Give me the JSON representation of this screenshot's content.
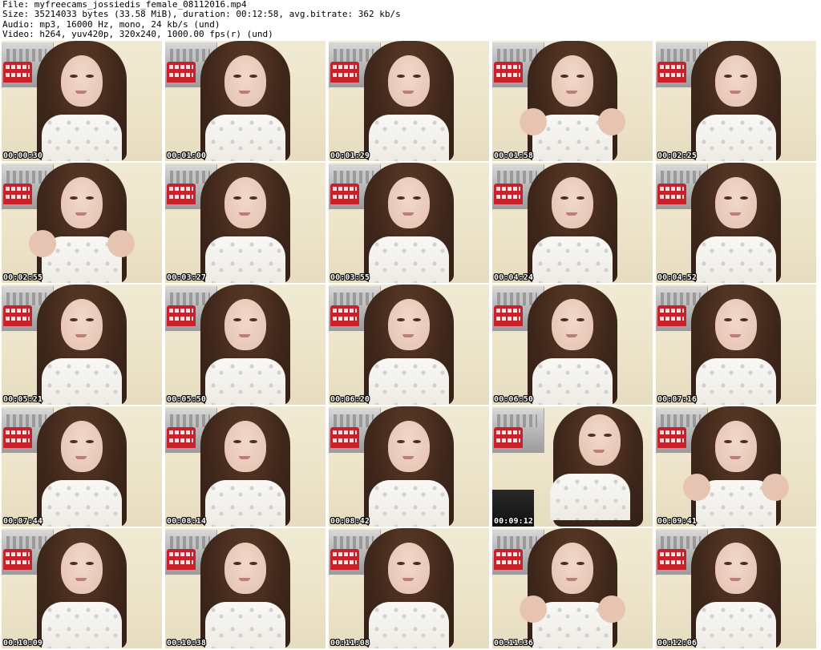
{
  "header": {
    "file": "File: myfreecams_jossiedis_female_08112016.mp4",
    "size": "Size: 35214033 bytes (33.58 MiB), duration: 00:12:58, avg.bitrate: 362 kb/s",
    "audio": "Audio: mp3, 16000 Hz, mono, 24 kb/s (und)",
    "video": "Video: h264, yuv420p, 320x240, 1000.00 fps(r) (und)"
  },
  "thumbnails": [
    "00:00:30",
    "00:01:00",
    "00:01:29",
    "00:01:58",
    "00:02:25",
    "00:02:55",
    "00:03:27",
    "00:03:55",
    "00:04:24",
    "00:04:52",
    "00:05:21",
    "00:05:50",
    "00:06:20",
    "00:06:50",
    "00:07:16",
    "00:07:44",
    "00:08:14",
    "00:08:42",
    "00:09:12",
    "00:09:41",
    "00:10:09",
    "00:10:38",
    "00:11:08",
    "00:11:36",
    "00:12:06"
  ]
}
